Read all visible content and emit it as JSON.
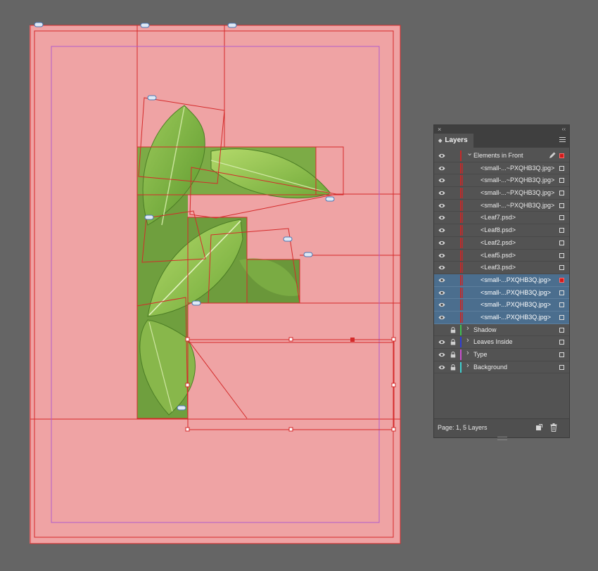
{
  "layers_panel": {
    "tab_label": "Layers",
    "close_glyph": "×",
    "collapse_glyph": "‹‹",
    "tab_glyph": "◆",
    "rows": [
      {
        "label": "Elements in Front",
        "kind": "layer",
        "expanded": true,
        "color": "#c62828",
        "visible": true,
        "locked": false,
        "selected": false,
        "target": true
      },
      {
        "label": "<small-...~PXQHB3Q.jpg>",
        "kind": "object",
        "visible": true,
        "selected": false
      },
      {
        "label": "<small-...~PXQHB3Q.jpg>",
        "kind": "object",
        "visible": true,
        "selected": false
      },
      {
        "label": "<small-...~PXQHB3Q.jpg>",
        "kind": "object",
        "visible": true,
        "selected": false
      },
      {
        "label": "<small-...~PXQHB3Q.jpg>",
        "kind": "object",
        "visible": true,
        "selected": false
      },
      {
        "label": "<Leaf7.psd>",
        "kind": "object",
        "visible": true,
        "selected": false
      },
      {
        "label": "<Leaf8.psd>",
        "kind": "object",
        "visible": true,
        "selected": false
      },
      {
        "label": "<Leaf2.psd>",
        "kind": "object",
        "visible": true,
        "selected": false
      },
      {
        "label": "<Leaf5.psd>",
        "kind": "object",
        "visible": true,
        "selected": false
      },
      {
        "label": "<Leaf3.psd>",
        "kind": "object",
        "visible": true,
        "selected": false
      },
      {
        "label": "<small-...PXQHB3Q.jpg>",
        "kind": "object",
        "visible": true,
        "selected": true,
        "filled_square": true
      },
      {
        "label": "<small-...PXQHB3Q.jpg>",
        "kind": "object",
        "visible": true,
        "selected": true
      },
      {
        "label": "<small-...PXQHB3Q.jpg>",
        "kind": "object",
        "visible": true,
        "selected": true
      },
      {
        "label": "<small-...PXQHB3Q.jpg>",
        "kind": "object",
        "visible": true,
        "selected": true
      },
      {
        "label": "Shadow",
        "kind": "layer",
        "expanded": false,
        "color": "#3fbf52",
        "visible": false,
        "locked": true,
        "selected": false
      },
      {
        "label": "Leaves Inside",
        "kind": "layer",
        "expanded": false,
        "color": "#2f3dd6",
        "visible": true,
        "locked": true,
        "selected": false
      },
      {
        "label": "Type",
        "kind": "layer",
        "expanded": false,
        "color": "#c84fcf",
        "visible": true,
        "locked": true,
        "selected": false
      },
      {
        "label": "Background",
        "kind": "layer",
        "expanded": false,
        "color": "#3fd0d0",
        "visible": true,
        "locked": true,
        "selected": false
      }
    ],
    "footer_status": "Page: 1, 5 Layers"
  },
  "colors": {
    "page_fill": "#efa3a4",
    "frame_red": "#d42a2a",
    "margin_magenta": "#b05ccc",
    "selection_row": "#4b6e8e",
    "panel_bg": "#535353",
    "workspace_bg": "#656565"
  },
  "icons": {
    "visibility": "eye-icon",
    "lock": "lock-icon",
    "expand": "chevron-right-icon",
    "collapse": "chevron-down-icon",
    "edit": "pencil-icon",
    "new_layer": "new-layer-icon",
    "delete": "trash-icon",
    "link": "link-icon"
  }
}
